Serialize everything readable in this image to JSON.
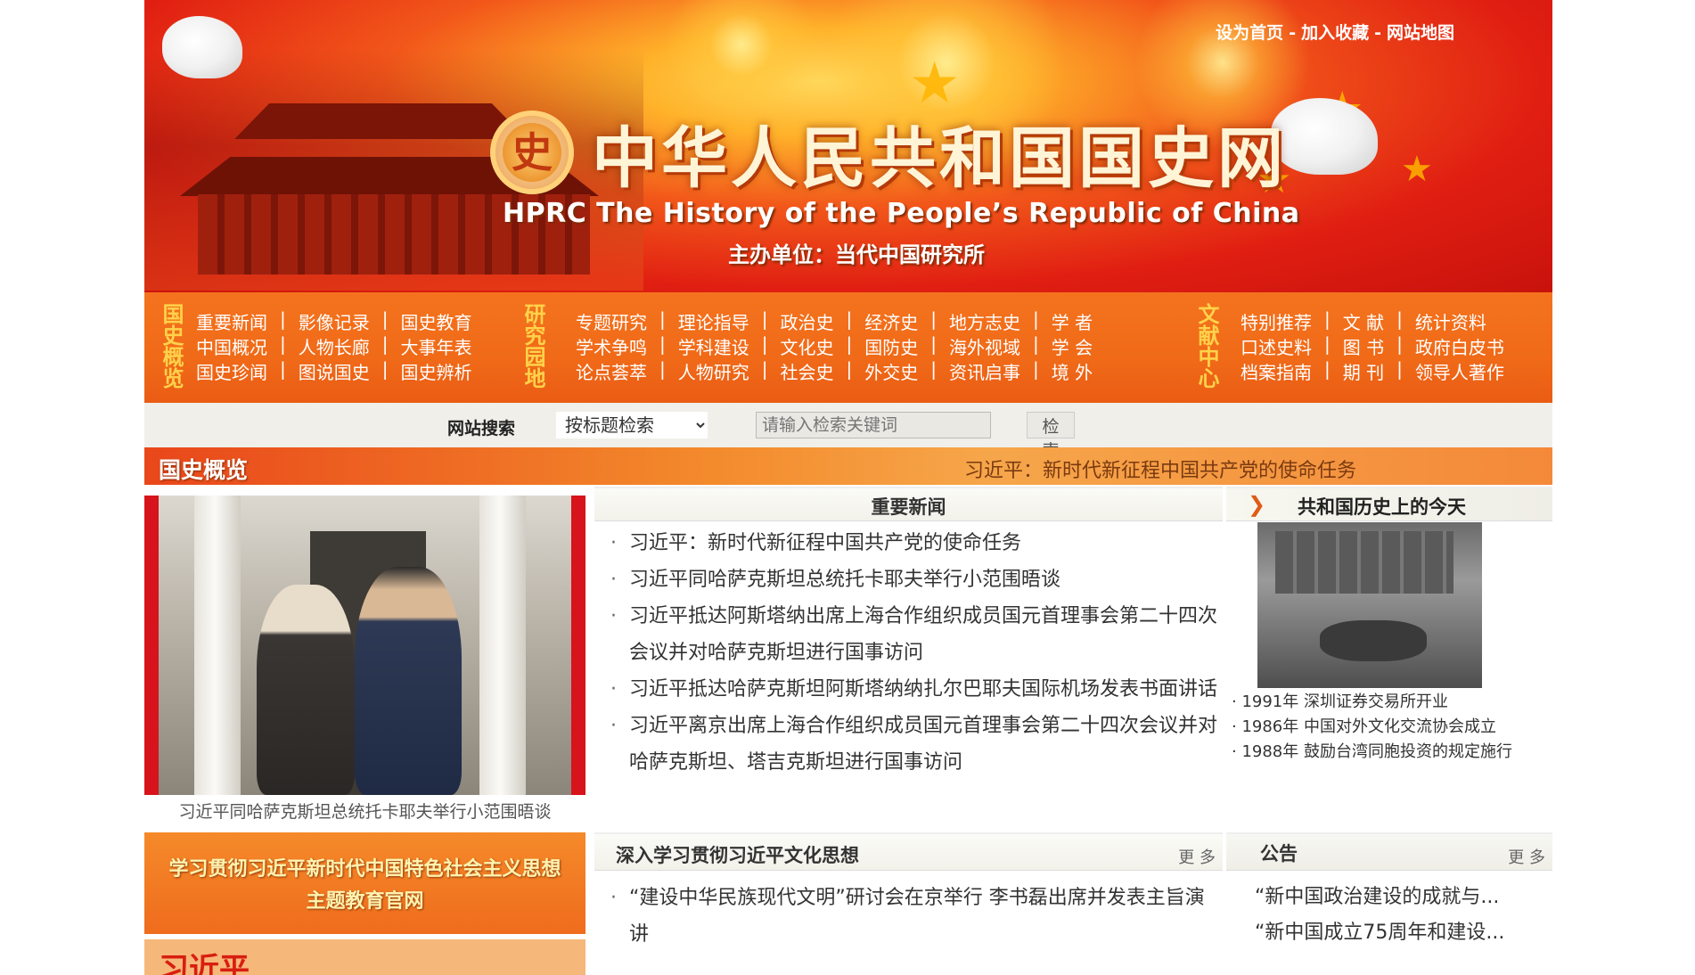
{
  "header": {
    "title": "中华人民共和国国史网",
    "subtitle": "HPRC  The History of the People’s Republic of China",
    "sponsor": "主办单位：当代中国研究所",
    "toplinks": [
      "设为首页",
      "加入收藏",
      "网站地图"
    ],
    "toplink_separator": "-",
    "logo_glyph": "史"
  },
  "nav": {
    "group1": {
      "label": "国史概览",
      "rows": [
        [
          "重要新闻",
          "影像记录",
          "国史教育"
        ],
        [
          "中国概况",
          "人物长廊",
          "大事年表"
        ],
        [
          "国史珍闻",
          "图说国史",
          "国史辨析"
        ]
      ]
    },
    "group2": {
      "label": "研究园地",
      "rows": [
        [
          "专题研究",
          "理论指导",
          "政治史",
          "经济史",
          "地方志史",
          "学 者"
        ],
        [
          "学术争鸣",
          "学科建设",
          "文化史",
          "国防史",
          "海外视域",
          "学 会"
        ],
        [
          "论点荟萃",
          "人物研究",
          "社会史",
          "外交史",
          "资讯启事",
          "境 外"
        ]
      ]
    },
    "group3": {
      "label": "文献中心",
      "rows": [
        [
          "特别推荐",
          "文 献",
          "统计资料"
        ],
        [
          "口述史料",
          "图 书",
          "政府白皮书"
        ],
        [
          "档案指南",
          "期 刊",
          "领导人著作"
        ]
      ]
    },
    "separator": "|"
  },
  "search": {
    "label": "网站搜索",
    "select_value": "按标题检索",
    "placeholder": "请输入检索关键词",
    "button": "检 索"
  },
  "section": {
    "title": "国史概览",
    "ticker": "习近平：新时代新征程中国共产党的使命任务"
  },
  "featured": {
    "caption": "习近平同哈萨克斯坦总统托卡耶夫举行小范围晤谈"
  },
  "promo": {
    "line1": "学习贯彻习近平新时代中国特色社会主义思想",
    "line2": "主题教育官网",
    "banner2": "习近平"
  },
  "news": {
    "title": "重要新闻",
    "bullet": "·",
    "items": [
      "习近平：新时代新征程中国共产党的使命任务",
      "习近平同哈萨克斯坦总统托卡耶夫举行小范围晤谈",
      "习近平抵达阿斯塔纳出席上海合作组织成员国元首理事会第二十四次会议并对哈萨克斯坦进行国事访问",
      "习近平抵达哈萨克斯坦阿斯塔纳纳扎尔巴耶夫国际机场发表书面讲话",
      "习近平离京出席上海合作组织成员国元首理事会第二十四次会议并对哈萨克斯坦、塔吉克斯坦进行国事访问"
    ]
  },
  "study": {
    "title": "深入学习贯彻习近平文化思想",
    "more": "更 多",
    "items": [
      "“建设中华民族现代文明”研讨会在京举行 李书磊出席并发表主旨演讲"
    ]
  },
  "today": {
    "title": "共和国历史上的今天",
    "arrow": "❯",
    "items": [
      "· 1991年 深圳证券交易所开业",
      "· 1986年 中国对外文化交流协会成立",
      "· 1988年 鼓励台湾同胞投资的规定施行"
    ]
  },
  "notice": {
    "title": "公告",
    "more": "更 多",
    "items": [
      "“新中国政治建设的成就与...",
      "“新中国成立75周年和建设..."
    ]
  },
  "colors": {
    "banner_red": "#e01e12",
    "nav_orange": "#f06a18",
    "nav_label_gold": "#ffd24a",
    "featured_red": "#d7131b"
  }
}
